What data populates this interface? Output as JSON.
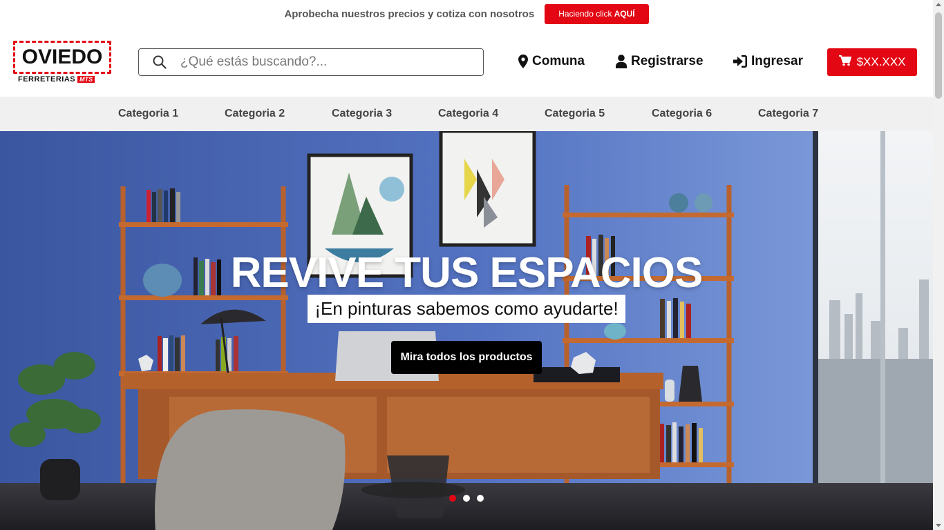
{
  "promo": {
    "text": "Aprobecha nuestros precios y cotiza con nosotros",
    "button_prefix": "Haciendo click",
    "button_emphasis": "AQUÍ"
  },
  "logo": {
    "word": "OVIEDO",
    "sub_text": "FERRETERIAS",
    "sub_tag": "MTS"
  },
  "search": {
    "placeholder": "¿Qué estás buscando?..."
  },
  "nav": {
    "comuna": "Comuna",
    "register": "Registrarse",
    "login": "Ingresar",
    "cart_total": "$XX.XXX"
  },
  "categories": [
    "Categoria 1",
    "Categoria 2",
    "Categoria 3",
    "Categoria 4",
    "Categoria 5",
    "Categoria 6",
    "Categoria 7"
  ],
  "hero": {
    "title": "REVIVE TUS ESPACIOS",
    "subtitle": "¡En pinturas sabemos como ayudarte!",
    "cta": "Mira todos los productos",
    "slides": 3,
    "active_slide": 1
  },
  "colors": {
    "brand_red": "#e30613",
    "wall_blue": "#4d6ab0",
    "category_bar": "#f0f0f0"
  },
  "icons": [
    "search-icon",
    "map-marker-icon",
    "user-icon",
    "sign-in-icon",
    "cart-icon"
  ]
}
